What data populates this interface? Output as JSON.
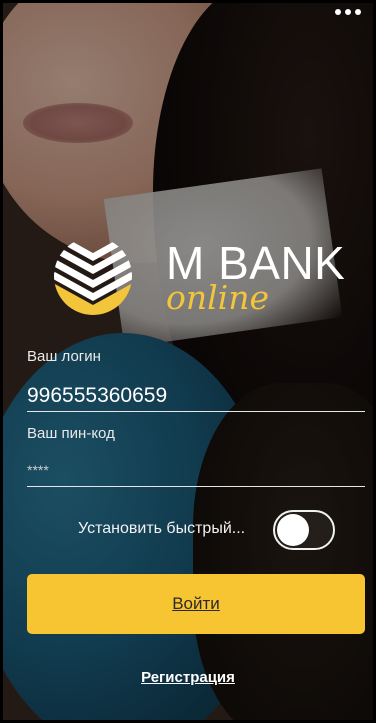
{
  "brand": {
    "name": "M BANK",
    "tagline": "online"
  },
  "login": {
    "label": "Ваш логин",
    "value": "996555360659"
  },
  "pin": {
    "label": "Ваш пин-код",
    "value": "****"
  },
  "quick_login": {
    "label": "Установить быстрый...",
    "enabled": false
  },
  "actions": {
    "login_label": "Войти",
    "register_label": "Регистрация"
  },
  "colors": {
    "accent": "#f7c532",
    "text": "#ffffff"
  },
  "icons": {
    "menu": "more-dots-icon",
    "logo": "mbank-logo-icon"
  }
}
